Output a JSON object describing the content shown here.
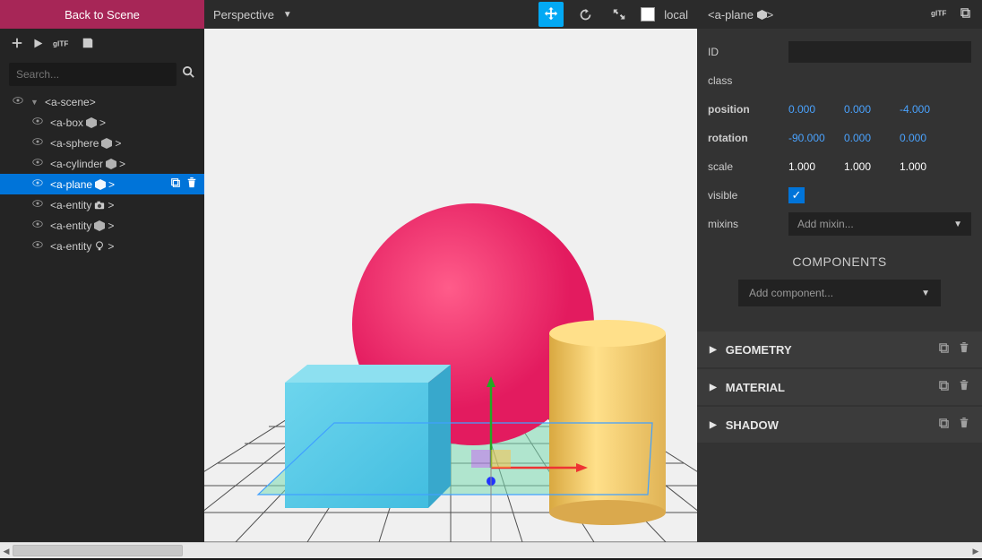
{
  "left": {
    "back_label": "Back to Scene",
    "search_placeholder": "Search..."
  },
  "tree": {
    "root": "<a-scene>",
    "children": [
      {
        "name": "<a-box",
        "icon": "box-icon"
      },
      {
        "name": "<a-sphere",
        "icon": "box-icon"
      },
      {
        "name": "<a-cylinder",
        "icon": "box-icon"
      },
      {
        "name": "<a-plane",
        "icon": "box-icon",
        "selected": true
      },
      {
        "name": "<a-entity",
        "icon": "camera-icon"
      },
      {
        "name": "<a-entity",
        "icon": "box-icon"
      },
      {
        "name": "<a-entity",
        "icon": "light-icon"
      }
    ]
  },
  "viewport": {
    "camera_label": "Perspective",
    "local_label": "local"
  },
  "inspector": {
    "title": "<a-plane",
    "title_tail": ">",
    "id_label": "ID",
    "id_value": "",
    "class_label": "class",
    "class_value": "",
    "position_label": "position",
    "position": [
      "0.000",
      "0.000",
      "-4.000"
    ],
    "rotation_label": "rotation",
    "rotation": [
      "-90.000",
      "0.000",
      "0.000"
    ],
    "scale_label": "scale",
    "scale": [
      "1.000",
      "1.000",
      "1.000"
    ],
    "visible_label": "visible",
    "visible": true,
    "mixins_label": "mixins",
    "mixins_placeholder": "Add mixin...",
    "components_title": "COMPONENTS",
    "add_component_placeholder": "Add component...",
    "components": [
      "GEOMETRY",
      "MATERIAL",
      "SHADOW"
    ]
  }
}
